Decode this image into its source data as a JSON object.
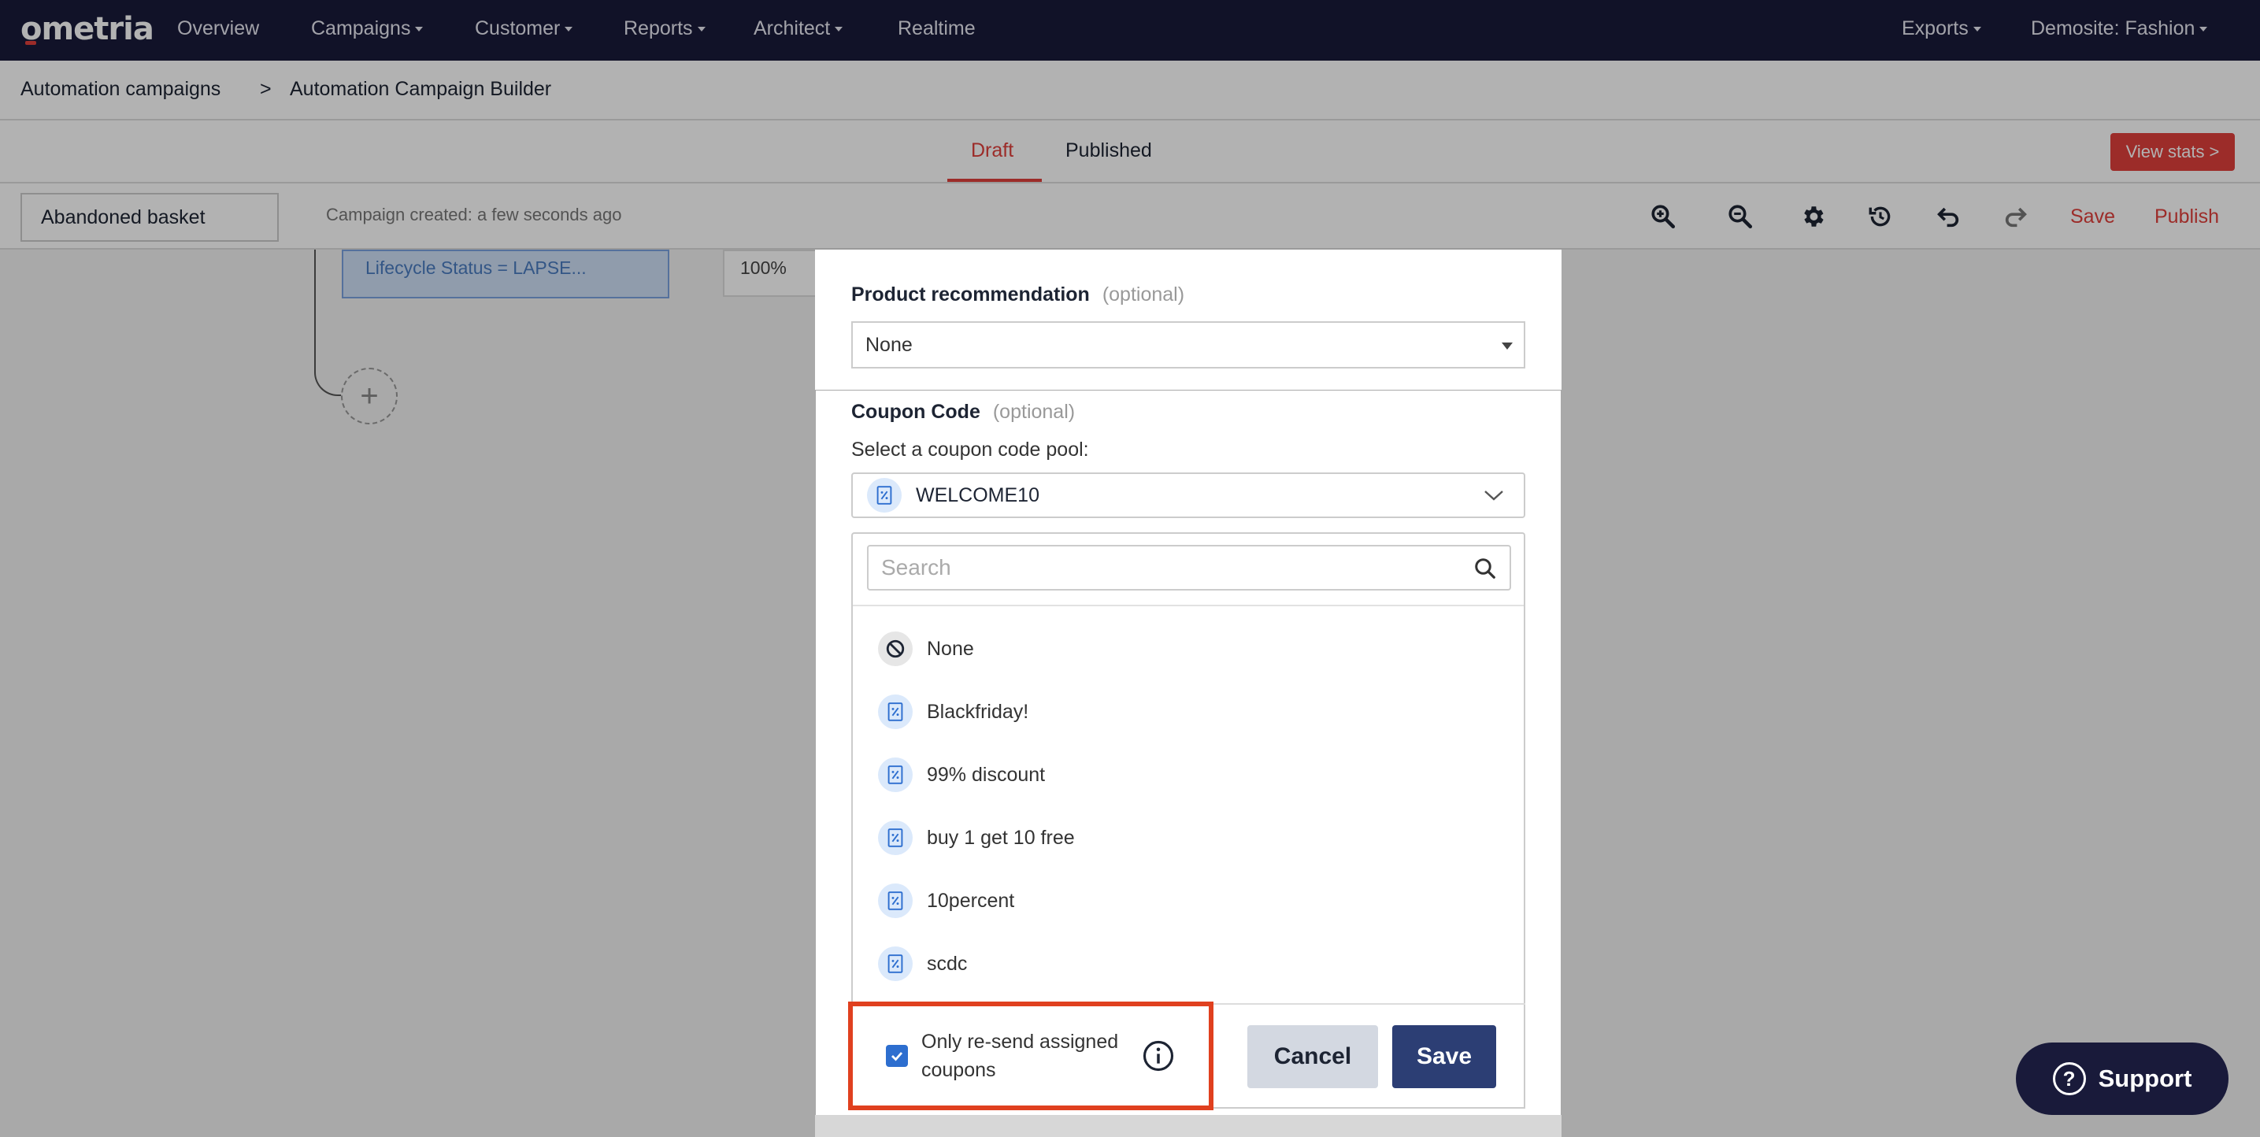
{
  "nav": {
    "logo": "ometria",
    "items": [
      {
        "label": "Overview",
        "has_menu": false
      },
      {
        "label": "Campaigns",
        "has_menu": true
      },
      {
        "label": "Customer",
        "has_menu": true
      },
      {
        "label": "Reports",
        "has_menu": true
      },
      {
        "label": "Architect",
        "has_menu": true
      },
      {
        "label": "Realtime",
        "has_menu": false
      }
    ],
    "right": [
      {
        "label": "Exports",
        "has_menu": true
      },
      {
        "label": "Demosite: Fashion",
        "has_menu": true
      }
    ]
  },
  "breadcrumb": {
    "parent": "Automation campaigns",
    "separator": ">",
    "current": "Automation Campaign Builder"
  },
  "tabs": {
    "draft": "Draft",
    "published": "Published",
    "active": "Draft",
    "view_stats": "View stats >"
  },
  "toolbar": {
    "campaign_name": "Abandoned basket",
    "created": "Campaign created: a few seconds ago",
    "icons": [
      "zoom-in-icon",
      "zoom-out-icon",
      "gear-icon",
      "history-icon",
      "undo-icon",
      "redo-icon"
    ],
    "save": "Save",
    "publish": "Publish"
  },
  "canvas": {
    "lifecycle_node": "Lifecycle Status = LAPSE...",
    "split_percent": "100%",
    "add_symbol": "+"
  },
  "modal": {
    "product_rec": {
      "label": "Product recommendation",
      "optional": "(optional)",
      "value": "None"
    },
    "coupon": {
      "label": "Coupon Code",
      "optional": "(optional)",
      "select_label": "Select a coupon code pool:",
      "selected": "WELCOME10",
      "search_placeholder": "Search",
      "options": [
        "None",
        "Blackfriday!",
        "99% discount",
        "buy 1 get 10 free",
        "10percent",
        "scdc"
      ]
    },
    "resend": {
      "label": "Only re-send assigned coupons",
      "checked": true
    },
    "cancel": "Cancel",
    "save": "Save"
  },
  "support": {
    "label": "Support"
  },
  "colors": {
    "nav_bg": "#191a3a",
    "accent_red": "#e0403c",
    "primary_blue": "#2c3e74",
    "highlight": "#e0401f"
  }
}
